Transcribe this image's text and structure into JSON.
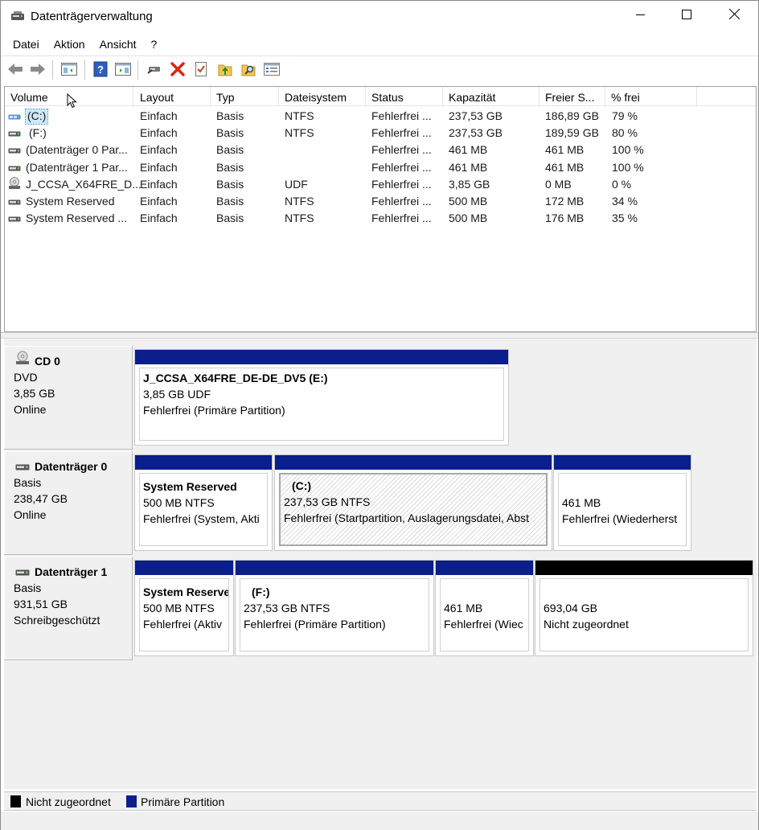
{
  "window": {
    "title": "Datenträgerverwaltung"
  },
  "menu": [
    "Datei",
    "Aktion",
    "Ansicht",
    "?"
  ],
  "toolbar": [
    "back-icon",
    "forward-icon",
    "show-hide-console-tree-icon",
    "help-icon",
    "show-hide-action-pane-icon",
    "connect-virtual-disk-icon",
    "delete-icon",
    "check-icon",
    "export-list-icon",
    "search-icon",
    "properties-icon"
  ],
  "list": {
    "columns": [
      "Volume",
      "Layout",
      "Typ",
      "Dateisystem",
      "Status",
      "Kapazität",
      "Freier S...",
      "% frei"
    ],
    "rows": [
      {
        "icon": "volume-drive-icon",
        "volume": "(C:)",
        "layout": "Einfach",
        "typ": "Basis",
        "fs": "NTFS",
        "status": "Fehlerfrei ...",
        "capacity": "237,53 GB",
        "free": "186,89 GB",
        "pct": "79 %"
      },
      {
        "icon": "volume-drive-icon",
        "volume": "(F:)",
        "layout": "Einfach",
        "typ": "Basis",
        "fs": "NTFS",
        "status": "Fehlerfrei ...",
        "capacity": "237,53 GB",
        "free": "189,59 GB",
        "pct": "80 %"
      },
      {
        "icon": "volume-drive-icon",
        "volume": "(Datenträger 0 Par...",
        "layout": "Einfach",
        "typ": "Basis",
        "fs": "",
        "status": "Fehlerfrei ...",
        "capacity": "461 MB",
        "free": "461 MB",
        "pct": "100 %"
      },
      {
        "icon": "volume-drive-icon",
        "volume": "(Datenträger 1 Par...",
        "layout": "Einfach",
        "typ": "Basis",
        "fs": "",
        "status": "Fehlerfrei ...",
        "capacity": "461 MB",
        "free": "461 MB",
        "pct": "100 %"
      },
      {
        "icon": "cd-drive-icon",
        "volume": "J_CCSA_X64FRE_D...",
        "layout": "Einfach",
        "typ": "Basis",
        "fs": "UDF",
        "status": "Fehlerfrei ...",
        "capacity": "3,85 GB",
        "free": "0 MB",
        "pct": "0 %"
      },
      {
        "icon": "volume-drive-icon",
        "volume": "System Reserved",
        "layout": "Einfach",
        "typ": "Basis",
        "fs": "NTFS",
        "status": "Fehlerfrei ...",
        "capacity": "500 MB",
        "free": "172 MB",
        "pct": "34 %"
      },
      {
        "icon": "volume-drive-icon",
        "volume": "System Reserved ...",
        "layout": "Einfach",
        "typ": "Basis",
        "fs": "NTFS",
        "status": "Fehlerfrei ...",
        "capacity": "500 MB",
        "free": "176 MB",
        "pct": "35 %"
      }
    ]
  },
  "disks": [
    {
      "name": "CD 0",
      "type": "DVD",
      "size": "3,85 GB",
      "state": "Online",
      "partitions": [
        {
          "title": "J_CCSA_X64FRE_DE-DE_DV5  (E:)",
          "size": "3,85 GB UDF",
          "status": "Fehlerfrei (Primäre Partition)"
        }
      ]
    },
    {
      "name": "Datenträger 0",
      "type": "Basis",
      "size": "238,47 GB",
      "state": "Online",
      "partitions": [
        {
          "title": "System Reserved",
          "size": "500 MB NTFS",
          "status": "Fehlerfrei (System, Akti"
        },
        {
          "title": "(C:)",
          "size": "237,53 GB NTFS",
          "status": "Fehlerfrei (Startpartition, Auslagerungsdatei, Abst"
        },
        {
          "title": "",
          "size": "461 MB",
          "status": "Fehlerfrei (Wiederherst"
        }
      ]
    },
    {
      "name": "Datenträger 1",
      "type": "Basis",
      "size": "931,51 GB",
      "state": "Schreibgeschützt",
      "partitions": [
        {
          "title": "System Reserve",
          "size": "500 MB NTFS",
          "status": "Fehlerfrei (Aktiv"
        },
        {
          "title": "(F:)",
          "size": "237,53 GB NTFS",
          "status": "Fehlerfrei (Primäre Partition)"
        },
        {
          "title": "",
          "size": "461 MB",
          "status": "Fehlerfrei (Wiec"
        },
        {
          "title": "",
          "size": "693,04 GB",
          "status": "Nicht zugeordnet"
        }
      ]
    }
  ],
  "legend": [
    {
      "label": "Nicht zugeordnet",
      "color": "#000000"
    },
    {
      "label": "Primäre Partition",
      "color": "#0a1e8c"
    }
  ],
  "colors": {
    "primary": "#0a1e8c",
    "unallocated": "#000000",
    "selection": "#cce8ff"
  }
}
